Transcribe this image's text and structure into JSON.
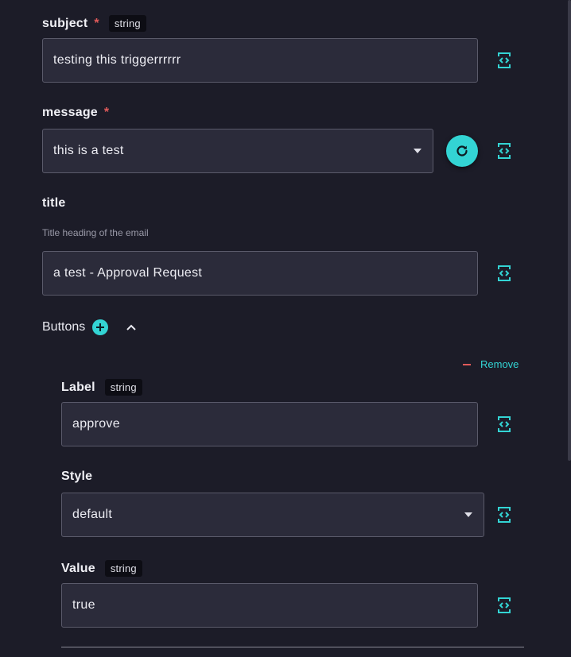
{
  "fields": {
    "subject": {
      "label": "subject",
      "required": "*",
      "type": "string",
      "value": "testing this triggerrrrrr"
    },
    "message": {
      "label": "message",
      "required": "*",
      "value": "this is a test"
    },
    "title": {
      "label": "title",
      "help": "Title heading of the email",
      "value": "a test - Approval Request"
    }
  },
  "buttons": {
    "label": "Buttons",
    "remove_label": "Remove",
    "item": {
      "label_field": {
        "label": "Label",
        "type": "string",
        "value": "approve"
      },
      "style_field": {
        "label": "Style",
        "value": "default"
      },
      "value_field": {
        "label": "Value",
        "type": "string",
        "value": "true"
      }
    }
  },
  "colors": {
    "accent": "#33d4d4",
    "required": "#e05a5a",
    "background": "#1c1c28",
    "input_bg": "#2b2b3a"
  },
  "icons": [
    "code-toggle-icon",
    "refresh-icon",
    "plus-icon",
    "chevron-up-icon",
    "minus-icon",
    "caret-down-icon"
  ]
}
